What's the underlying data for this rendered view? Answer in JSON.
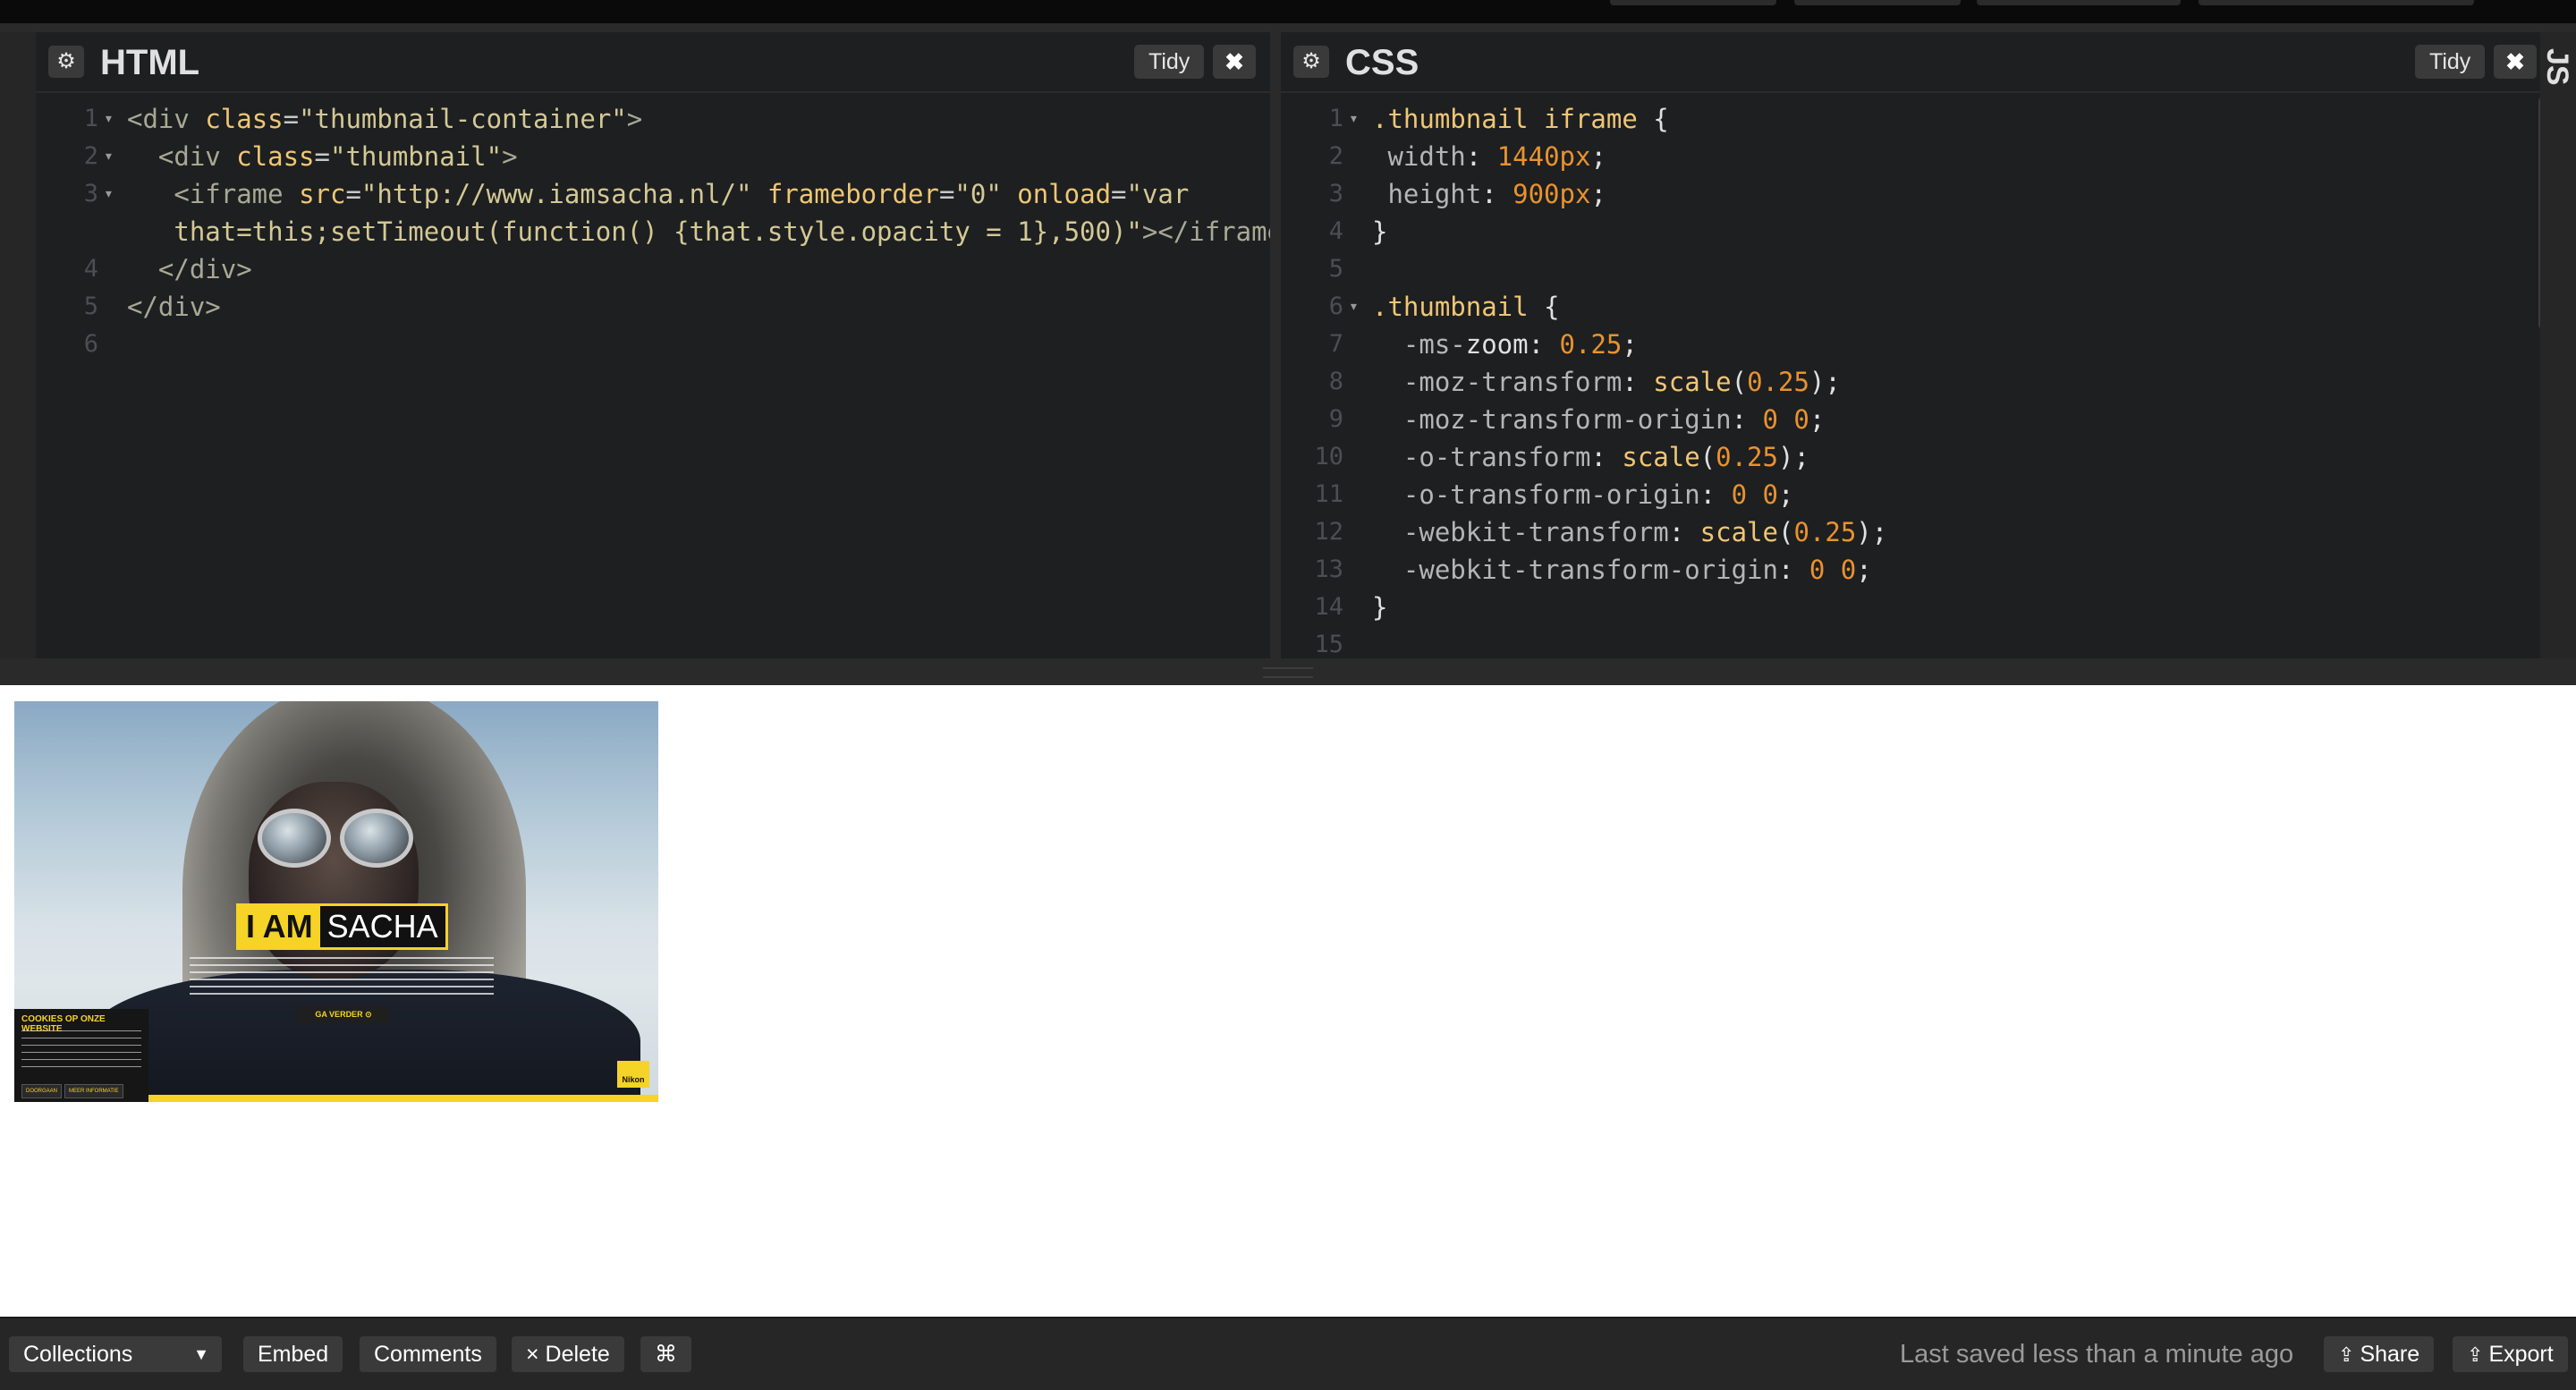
{
  "html_panel": {
    "title": "HTML",
    "tidy_label": "Tidy",
    "close_label": "✖",
    "lines": [
      {
        "num": "1",
        "fold": true,
        "parts": [
          [
            "t-tag",
            "<div "
          ],
          [
            "t-attr",
            "class"
          ],
          [
            "t-eq",
            "="
          ],
          [
            "t-str",
            "\"thumbnail-container\""
          ],
          [
            "t-tag",
            ">"
          ]
        ]
      },
      {
        "num": "2",
        "fold": true,
        "parts": [
          [
            "t-tag",
            "  <div "
          ],
          [
            "t-attr",
            "class"
          ],
          [
            "t-eq",
            "="
          ],
          [
            "t-str",
            "\"thumbnail\""
          ],
          [
            "t-tag",
            ">"
          ]
        ]
      },
      {
        "num": "3",
        "fold": true,
        "parts": [
          [
            "t-tag",
            "   <iframe "
          ],
          [
            "t-attr",
            "src"
          ],
          [
            "t-eq",
            "="
          ],
          [
            "t-str",
            "\"http://www.iamsacha.nl/\""
          ],
          [
            "t-eq",
            " "
          ],
          [
            "t-attr",
            "frameborder"
          ],
          [
            "t-eq",
            "="
          ],
          [
            "t-str",
            "\"0\""
          ],
          [
            "t-eq",
            " "
          ],
          [
            "t-attr",
            "onload"
          ],
          [
            "t-eq",
            "="
          ],
          [
            "t-str",
            "\"var"
          ]
        ]
      },
      {
        "num": "",
        "fold": false,
        "parts": [
          [
            "t-str",
            "   that=this;setTimeout(function() {that.style.opacity = 1},500)\""
          ],
          [
            "t-tag",
            "></iframe>"
          ]
        ]
      },
      {
        "num": "4",
        "fold": false,
        "parts": [
          [
            "t-tag",
            "  </div>"
          ]
        ]
      },
      {
        "num": "5",
        "fold": false,
        "parts": [
          [
            "t-tag",
            "</div>"
          ]
        ]
      },
      {
        "num": "6",
        "fold": false,
        "parts": [
          [
            "t-eq",
            ""
          ]
        ]
      }
    ]
  },
  "css_panel": {
    "title": "CSS",
    "tidy_label": "Tidy",
    "close_label": "✖",
    "lines": [
      {
        "num": "1",
        "fold": true,
        "parts": [
          [
            "t-sel",
            ".thumbnail iframe"
          ],
          [
            "t-punc",
            " {"
          ]
        ]
      },
      {
        "num": "2",
        "fold": false,
        "parts": [
          [
            "t-prop",
            " width"
          ],
          [
            "t-punc",
            ": "
          ],
          [
            "t-num",
            "1440px"
          ],
          [
            "t-punc",
            ";"
          ]
        ]
      },
      {
        "num": "3",
        "fold": false,
        "parts": [
          [
            "t-prop",
            " height"
          ],
          [
            "t-punc",
            ": "
          ],
          [
            "t-num",
            "900px"
          ],
          [
            "t-punc",
            ";"
          ]
        ]
      },
      {
        "num": "4",
        "fold": false,
        "parts": [
          [
            "t-punc",
            "}"
          ]
        ]
      },
      {
        "num": "5",
        "fold": false,
        "parts": [
          [
            "t-eq",
            ""
          ]
        ]
      },
      {
        "num": "6",
        "fold": true,
        "parts": [
          [
            "t-sel",
            ".thumbnail"
          ],
          [
            "t-punc",
            " {"
          ]
        ]
      },
      {
        "num": "7",
        "fold": false,
        "parts": [
          [
            "t-prop",
            "  -ms-"
          ],
          [
            "t-punc",
            "zoom"
          ],
          [
            "t-punc",
            ": "
          ],
          [
            "t-num",
            "0.25"
          ],
          [
            "t-punc",
            ";"
          ]
        ]
      },
      {
        "num": "8",
        "fold": false,
        "parts": [
          [
            "t-prop",
            "  -moz-transform"
          ],
          [
            "t-punc",
            ": "
          ],
          [
            "t-fn",
            "scale"
          ],
          [
            "t-punc",
            "("
          ],
          [
            "t-num",
            "0.25"
          ],
          [
            "t-punc",
            ");"
          ]
        ]
      },
      {
        "num": "9",
        "fold": false,
        "parts": [
          [
            "t-prop",
            "  -moz-transform-origin"
          ],
          [
            "t-punc",
            ": "
          ],
          [
            "t-num",
            "0 0"
          ],
          [
            "t-punc",
            ";"
          ]
        ]
      },
      {
        "num": "10",
        "fold": false,
        "parts": [
          [
            "t-prop",
            "  -o-transform"
          ],
          [
            "t-punc",
            ": "
          ],
          [
            "t-fn",
            "scale"
          ],
          [
            "t-punc",
            "("
          ],
          [
            "t-num",
            "0.25"
          ],
          [
            "t-punc",
            ");"
          ]
        ]
      },
      {
        "num": "11",
        "fold": false,
        "parts": [
          [
            "t-prop",
            "  -o-transform-origin"
          ],
          [
            "t-punc",
            ": "
          ],
          [
            "t-num",
            "0 0"
          ],
          [
            "t-punc",
            ";"
          ]
        ]
      },
      {
        "num": "12",
        "fold": false,
        "parts": [
          [
            "t-prop",
            "  -webkit-transform"
          ],
          [
            "t-punc",
            ": "
          ],
          [
            "t-fn",
            "scale"
          ],
          [
            "t-punc",
            "("
          ],
          [
            "t-num",
            "0.25"
          ],
          [
            "t-punc",
            ");"
          ]
        ]
      },
      {
        "num": "13",
        "fold": false,
        "parts": [
          [
            "t-prop",
            "  -webkit-transform-origin"
          ],
          [
            "t-punc",
            ": "
          ],
          [
            "t-num",
            "0 0"
          ],
          [
            "t-punc",
            ";"
          ]
        ]
      },
      {
        "num": "14",
        "fold": false,
        "parts": [
          [
            "t-punc",
            "}"
          ]
        ]
      },
      {
        "num": "15",
        "fold": false,
        "parts": [
          [
            "t-eq",
            ""
          ]
        ]
      }
    ]
  },
  "js_tab": {
    "label": "JS"
  },
  "preview": {
    "headline_a": "I AM",
    "headline_b": "SACHA",
    "cta": "GA VERDER ⊙",
    "cookie_title": "COOKIES OP ONZE WEBSITE",
    "cookie_btn_1": "DOORGAAN",
    "cookie_btn_2": "MEER INFORMATIE",
    "brand": "Nikon"
  },
  "footer": {
    "collections_label": "Collections",
    "embed_label": "Embed",
    "comments_label": "Comments",
    "delete_label": "× Delete",
    "cmd_label": "⌘",
    "saved_text": "Last saved less than a minute ago",
    "share_label": "Share",
    "export_label": "Export"
  },
  "colors": {
    "accent_yellow": "#f5d327",
    "editor_bg": "#1d1f21",
    "chrome_bg": "#262626"
  }
}
